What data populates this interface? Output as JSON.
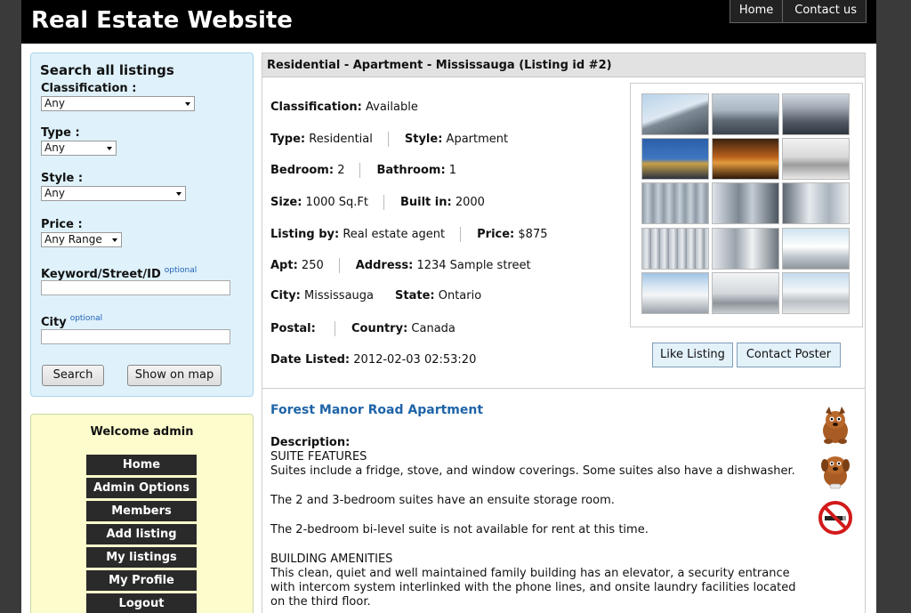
{
  "site": {
    "title": "Real Estate Website",
    "nav": [
      "Home",
      "Contact us"
    ]
  },
  "search": {
    "heading": "Search all listings",
    "classification_label": "Classification :",
    "classification_value": "Any",
    "type_label": "Type :",
    "type_value": "Any",
    "style_label": "Style :",
    "style_value": "Any",
    "price_label": "Price :",
    "price_value": "Any Range",
    "keyword_label": "Keyword/Street/ID",
    "keyword_hint": "optional",
    "keyword_value": "",
    "city_label": "City",
    "city_hint": "optional",
    "city_value": "",
    "search_button": "Search",
    "map_button": "Show on map"
  },
  "user_menu": {
    "welcome": "Welcome admin",
    "items": [
      "Home",
      "Admin Options",
      "Members",
      "Add listing",
      "My listings",
      "My Profile",
      "Logout"
    ]
  },
  "listing": {
    "heading": "Residential - Apartment - Mississauga (Listing id #2)",
    "fields": {
      "classification": {
        "label": "Classification:",
        "value": "Available"
      },
      "type": {
        "label": "Type:",
        "value": "Residential"
      },
      "style": {
        "label": "Style:",
        "value": "Apartment"
      },
      "bedroom": {
        "label": "Bedroom:",
        "value": "2"
      },
      "bathroom": {
        "label": "Bathroom:",
        "value": "1"
      },
      "size": {
        "label": "Size:",
        "value": "1000 Sq.Ft"
      },
      "built": {
        "label": "Built in:",
        "value": "2000"
      },
      "listing_by": {
        "label": "Listing by:",
        "value": "Real estate agent"
      },
      "price": {
        "label": "Price:",
        "value": "$875"
      },
      "apt": {
        "label": "Apt:",
        "value": "250"
      },
      "address": {
        "label": "Address:",
        "value": "1234 Sample street"
      },
      "city": {
        "label": "City:",
        "value": "Mississauga"
      },
      "state": {
        "label": "State:",
        "value": "Ontario"
      },
      "postal": {
        "label": "Postal:",
        "value": ""
      },
      "country": {
        "label": "Country:",
        "value": "Canada"
      },
      "date": {
        "label": "Date Listed:",
        "value": "2012-02-03 02:53:20"
      }
    },
    "like_button": "Like Listing",
    "contact_button": "Contact Poster",
    "title": "Forest Manor Road Apartment",
    "description_label": "Description:",
    "description": {
      "p1_heading": "SUITE FEATURES",
      "p1": "Suites include a fridge, stove, and window coverings. Some suites also have a dishwasher.",
      "p2": "The 2 and 3-bedroom suites have an ensuite storage room.",
      "p3": "The 2-bedroom bi-level suite is not available for rent at this time.",
      "p4_heading": "BUILDING AMENITIES",
      "p4": "This clean, quiet and well maintained family building has an elevator, a security entrance with intercom system interlinked with the phone lines, and onsite laundry facilities located on the third floor."
    },
    "feature_icons": [
      "dog-icon",
      "dog-icon",
      "no-smoking-icon"
    ]
  }
}
